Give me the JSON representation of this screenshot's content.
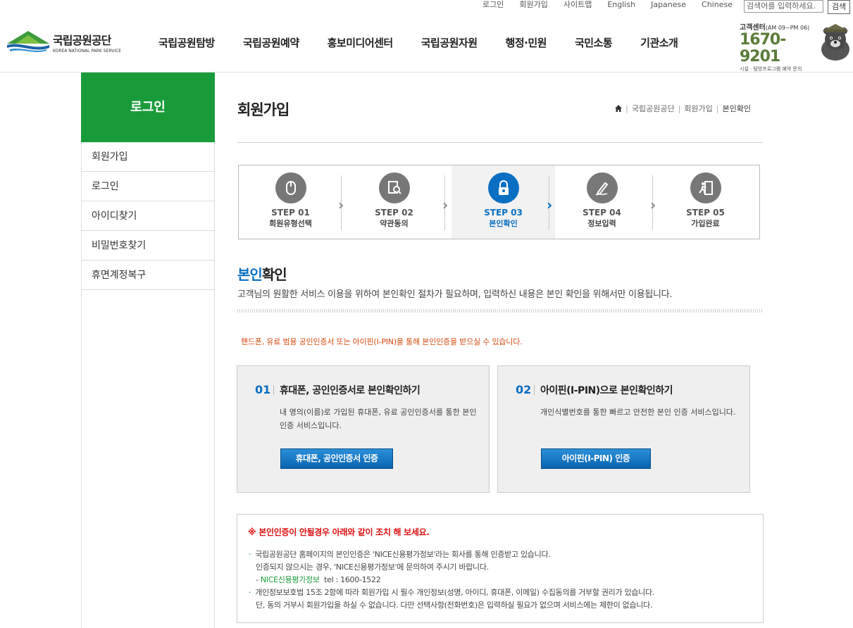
{
  "util": {
    "links": [
      "로그인",
      "회원가입",
      "사이트맵",
      "English",
      "Japanese",
      "Chinese"
    ],
    "search_placeholder": "검색어를 입력하세요.",
    "search_button": "검색"
  },
  "logo": {
    "kr": "국립공원공단",
    "en": "KOREA NATIONAL PARK SERVICE"
  },
  "gnb": [
    "국립공원탐방",
    "국립공원예약",
    "홍보미디어센터",
    "국립공원자원",
    "행정·민원",
    "국민소통",
    "기관소개"
  ],
  "cs": {
    "title": "고객센터",
    "hours": "(AM 09~PM 06)",
    "number": "1670-9201",
    "sub": "시설 · 탐방프로그램 예약 문의"
  },
  "sidebar": {
    "title": "로그인",
    "items": [
      "회원가입",
      "로그인",
      "아이디찾기",
      "비밀번호찾기",
      "휴면계정복구"
    ]
  },
  "page": {
    "title": "회원가입",
    "breadcrumb": [
      "국립공원공단",
      "회원가입",
      "본인확인"
    ]
  },
  "steps": [
    {
      "num": "STEP 01",
      "label": "회원유형선택",
      "icon": "mouse-icon"
    },
    {
      "num": "STEP 02",
      "label": "약관동의",
      "icon": "document-search-icon"
    },
    {
      "num": "STEP 03",
      "label": "본인확인",
      "icon": "lock-icon"
    },
    {
      "num": "STEP 04",
      "label": "정보입력",
      "icon": "pen-icon"
    },
    {
      "num": "STEP 05",
      "label": "가입완료",
      "icon": "exit-icon"
    }
  ],
  "section": {
    "title_hl": "본인",
    "title_rest": "확인",
    "desc": "고객님의 원활한 서비스 이용을 위하여 본인확인 절차가 필요하며, 입력하신 내용은 본인 확인을 위해서만 이용됩니다.",
    "notice": "핸드폰, 유료 범용 공인인증서 또는 아이핀(I-PIN)을 통해 본인인증을 받으실 수 있습니다."
  },
  "options": [
    {
      "no": "01",
      "title": "휴대폰, 공인인증서로 본인확인하기",
      "desc": "내 명의(이름)로 가입된 휴대폰, 유료 공인인증서를 통한 본인 인증 서비스입니다.",
      "button": "휴대폰, 공인인증서 인증"
    },
    {
      "no": "02",
      "title": "아이핀(I-PIN)으로 본인확인하기",
      "desc": "개인식별번호를 통한 빠르고 안전한 본인 인증 서비스입니다.",
      "button": "아이핀(I-PIN) 인증"
    }
  ],
  "help": {
    "title": "※ 본인인증이 안될경우 아래와 같이 조치 해 보세요.",
    "l1": "국립공원공단 홈페이지의 본인인증은 'NICE신용평가정보'라는 회사를 통해 인증받고 있습니다.",
    "l2": "인증되지 않으시는 경우, 'NICE신용평가정보'에 문의하여 주시기 바랍니다.",
    "l3_name": "NICE신용평가정보",
    "l3_tel": "tel : 1600-1522",
    "l4": "개인정보보호법 15조 2항에 따라 회원가입 시 필수 개인정보(성명, 아이디, 휴대폰, 이메일) 수집동의를 거부할 권리가 있습니다.",
    "l5": "단, 동의 거부시 회원가입을 하실 수 없습니다. 다만 선택사항(전화번호)은 입력하실 필요가 없으며 서비스에는 제한이 없습니다."
  }
}
